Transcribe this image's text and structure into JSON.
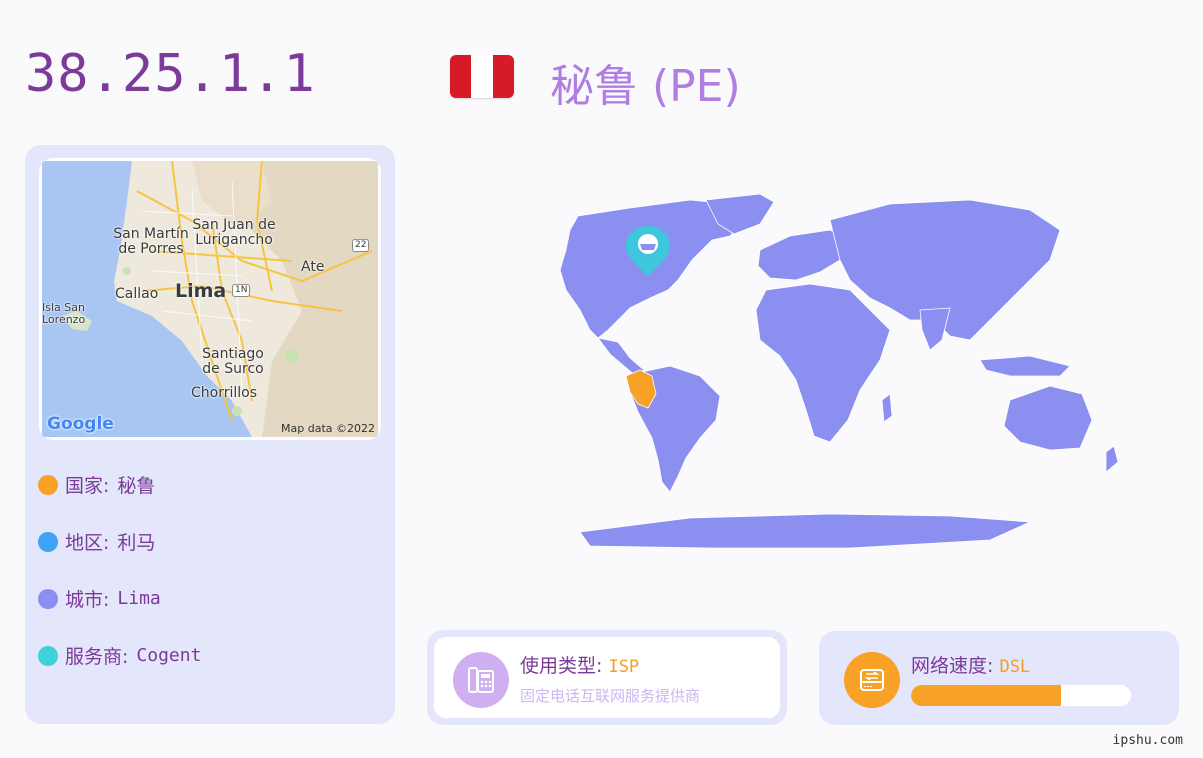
{
  "header": {
    "ip": "38.25.1.1",
    "country": "秘鲁 (PE)",
    "flag_icon": "peru-flag-icon",
    "flag_colors": [
      "#d71a28",
      "#ffffff"
    ]
  },
  "map": {
    "labels": {
      "san_martin": "San Martín de Porres",
      "san_juan": "San Juan de Lurigancho",
      "ate": "Ate",
      "callao": "Callao",
      "lima": "Lima",
      "isla": "Isla San Lorenzo",
      "santiago": "Santiago de Surco",
      "chorrillos": "Chorrillos",
      "road_1n": "1N",
      "road_22": "22"
    },
    "google": "Google",
    "credit": "Map data ©2022"
  },
  "info": [
    {
      "label": "国家:",
      "value": "秘鲁",
      "color": "#f7a226"
    },
    {
      "label": "地区:",
      "value": "利马",
      "color": "#3fa2f5"
    },
    {
      "label": "城市:",
      "value": "Lima",
      "color": "#8a8ff0"
    },
    {
      "label": "服务商:",
      "value": "Cogent",
      "color": "#3ed2dc"
    }
  ],
  "usage": {
    "title": "使用类型:",
    "value": "ISP",
    "subtitle": "固定电话互联网服务提供商",
    "icon": "phone-fax-icon",
    "icon_color": "#d0aef2"
  },
  "speed": {
    "title": "网络速度:",
    "value": "DSL",
    "icon": "speed-drive-icon",
    "icon_color": "#f7a226",
    "progress": 0.68
  },
  "world_map": {
    "land_color": "#8a8ff0",
    "highlight_color": "#f7a226",
    "marker_color": "#3ec6dc"
  },
  "footer": "ipshu.com"
}
